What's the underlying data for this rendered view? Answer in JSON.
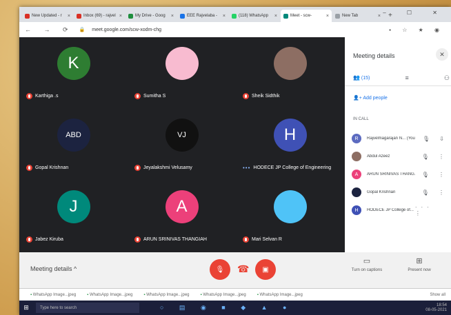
{
  "tabs": [
    {
      "label": "New Updated - r",
      "color": "#d93025",
      "active": false
    },
    {
      "label": "Inbox (69) - rajvel",
      "color": "#d93025",
      "active": false
    },
    {
      "label": "My Drive - Goog",
      "color": "#1e8e3e",
      "active": false
    },
    {
      "label": "EEE Rajvelaba - ",
      "color": "#1a73e8",
      "active": false
    },
    {
      "label": "(118) WhatsApp",
      "color": "#25d366",
      "active": false
    },
    {
      "label": "Meet - scw-",
      "color": "#00897b",
      "active": true
    },
    {
      "label": "New Tab",
      "color": "#9aa0a6",
      "active": false
    }
  ],
  "new_tab": "+",
  "url": "meet.google.com/scw-xodm-chg",
  "participants": [
    {
      "initial": "K",
      "name": "Karthiga .s",
      "color": "#2e7d32",
      "photo": false
    },
    {
      "initial": "",
      "name": "Sumitha S",
      "color": "#f8bbd0",
      "photo": true
    },
    {
      "initial": "",
      "name": "Sheik Sidthik",
      "color": "#8d6e63",
      "photo": true
    },
    {
      "initial": "ABD",
      "name": "Gopal Krishnan",
      "color": "#1c2340",
      "photo": true
    },
    {
      "initial": "VJ",
      "name": "Jeyalakshmi Velusamy",
      "color": "#111111",
      "photo": true
    },
    {
      "initial": "H",
      "name": "HODECE JP College of Engineering",
      "color": "#3f51b5",
      "photo": false
    },
    {
      "initial": "J",
      "name": "Jabez Kiruba",
      "color": "#00897b",
      "photo": false
    },
    {
      "initial": "A",
      "name": "ARUN SRINIVAS THANGIAH",
      "color": "#ec407a",
      "photo": false
    },
    {
      "initial": "",
      "name": "Mari Selvan R",
      "color": "#4fc3f7",
      "photo": true
    }
  ],
  "bottom": {
    "meeting_details": "Meeting details ^",
    "captions": "Turn on captions",
    "present": "Present now"
  },
  "downloads": [
    "WhatsApp Image...jpeg",
    "WhatsApp Image...jpeg",
    "WhatsApp Image...jpeg",
    "WhatsApp Image...jpeg",
    "WhatsApp Image...jpeg"
  ],
  "show_all": "Show all",
  "taskbar": {
    "search": "Type here to search",
    "time": "18:54",
    "date": "08-05-2021"
  },
  "panel": {
    "title": "Meeting details",
    "people_count": "(15)",
    "add_people": "Add people",
    "in_call": "IN CALL",
    "people": [
      {
        "initial": "R",
        "name": "Rajvelmagarajan N... (You)",
        "color": "#5c6bc0"
      },
      {
        "initial": "",
        "name": "Abdul Azeez",
        "color": "#8d6e63"
      },
      {
        "initial": "A",
        "name": "ARUN SRINIVAS THANG...",
        "color": "#ec407a"
      },
      {
        "initial": "",
        "name": "Gopal Krishnan",
        "color": "#1c2340"
      },
      {
        "initial": "H",
        "name": "HODECE JP College of...",
        "color": "#3f51b5"
      }
    ]
  }
}
